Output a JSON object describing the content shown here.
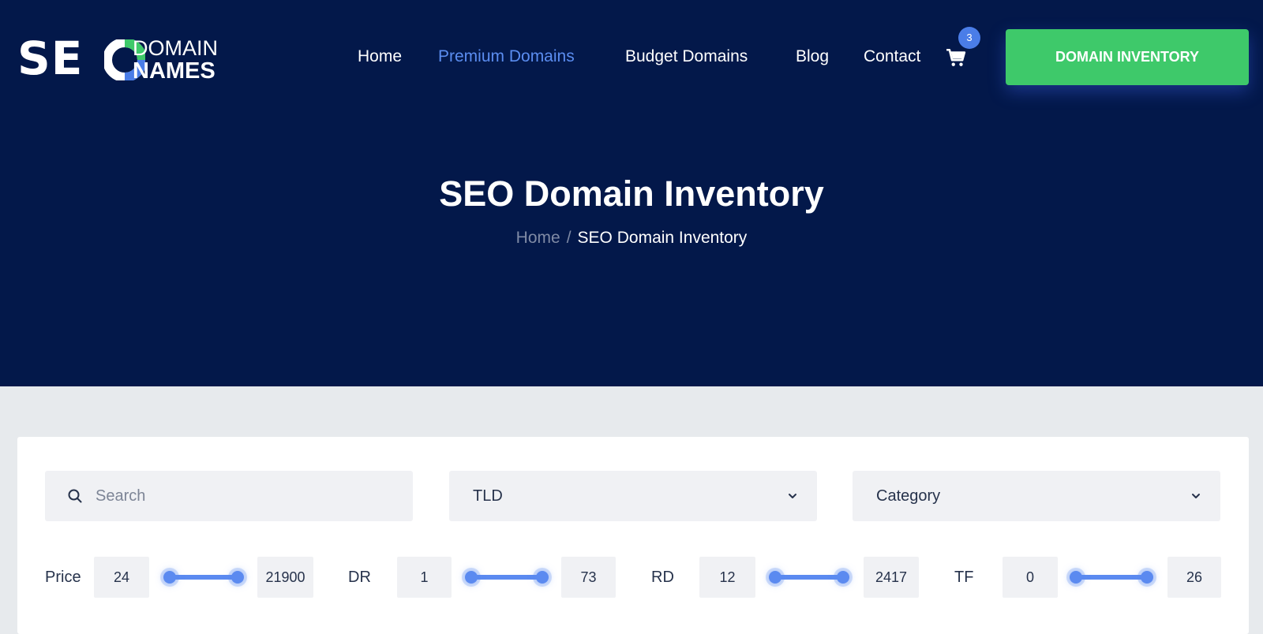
{
  "logo": {
    "seo": "SE",
    "domain": "DOMAIN",
    "names": "NAMES"
  },
  "nav": {
    "links": [
      "Home",
      "Premium Domains",
      "Budget Domains",
      "Blog",
      "Contact"
    ],
    "cart_count": "3",
    "cta": "DOMAIN INVENTORY"
  },
  "hero": {
    "title": "SEO Domain Inventory",
    "breadcrumb": {
      "home": "Home",
      "separator": "/",
      "current": "SEO Domain Inventory"
    }
  },
  "filters": {
    "search": {
      "placeholder": "Search"
    },
    "tld": {
      "value": "TLD"
    },
    "category": {
      "value": "Category"
    },
    "ranges": {
      "price": {
        "label": "Price",
        "min": "24",
        "max": "21900"
      },
      "dr": {
        "label": "DR",
        "min": "1",
        "max": "73"
      },
      "rd": {
        "label": "RD",
        "min": "12",
        "max": "2417"
      },
      "tf": {
        "label": "TF",
        "min": "0",
        "max": "26"
      }
    }
  },
  "colors": {
    "hero_bg": "#03184a",
    "accent_blue": "#5b8af0",
    "cta_green": "#3ec96a",
    "filter_bg": "#e7eaed"
  }
}
